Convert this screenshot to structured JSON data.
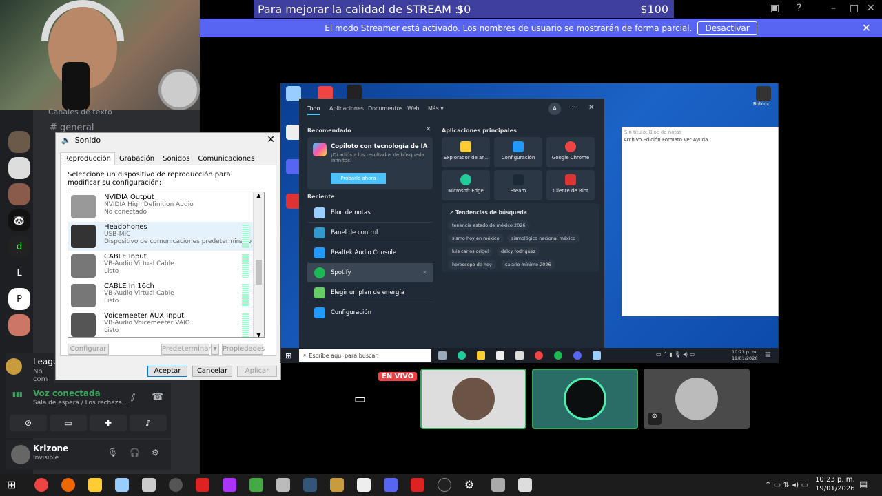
{
  "donation": {
    "text": "Para mejorar la calidad de STREAM :)",
    "current": "$0",
    "goal": "$100"
  },
  "streamer": {
    "message": "El modo Streamer está activado. Los nombres de usuario se mostrarán de forma parcial.",
    "button": "Desactivar"
  },
  "sidebar": {
    "letter": "L"
  },
  "channels": {
    "category": "Canales de texto",
    "items": [
      "general"
    ]
  },
  "game": {
    "name": "Leagu",
    "sub": "No com"
  },
  "voice": {
    "status": "Voz conectada",
    "location": "Sala de espera / Los rechaza..."
  },
  "user": {
    "name": "Krizone",
    "status": "Invisible"
  },
  "sonido": {
    "title": "Sonido",
    "tabs": [
      "Reproducción",
      "Grabación",
      "Sonidos",
      "Comunicaciones"
    ],
    "description": "Seleccione un dispositivo de reproducción para modificar su configuración:",
    "devices": [
      {
        "name": "NVIDIA Output",
        "driver": "NVIDIA High Definition Audio",
        "status": "No conectado"
      },
      {
        "name": "Headphones",
        "driver": "USB-MIC",
        "status": "Dispositivo de comunicaciones predeterminado"
      },
      {
        "name": "CABLE Input",
        "driver": "VB-Audio Virtual Cable",
        "status": "Listo"
      },
      {
        "name": "CABLE In 16ch",
        "driver": "VB-Audio Virtual Cable",
        "status": "Listo"
      },
      {
        "name": "Voicemeeter AUX Input",
        "driver": "VB-Audio Voicemeeter VAIO",
        "status": "Listo"
      }
    ],
    "btn_configurar": "Configurar",
    "btn_predeterminar": "Predeterminar",
    "btn_propiedades": "Propiedades",
    "btn_aceptar": "Aceptar",
    "btn_cancelar": "Cancelar",
    "btn_aplicar": "Aplicar"
  },
  "desktop": {
    "roblox": "Roblox",
    "notepad_title": "Sin título: Bloc de notas",
    "notepad_menu": "Archivo  Edición  Formato  Ver  Ayuda"
  },
  "startmenu": {
    "tabs": [
      "Todo",
      "Aplicaciones",
      "Documentos",
      "Web",
      "Más"
    ],
    "user_initial": "A",
    "recommended_header": "Recomendado",
    "copilot_title": "Copiloto con tecnología de IA",
    "copilot_desc": "¡Di adiós a los resultados de búsqueda infinitos!",
    "copilot_btn": "Probarlo ahora",
    "recent_header": "Reciente",
    "recent": [
      "Bloc de notas",
      "Panel de control",
      "Realtek Audio Console",
      "Spotify",
      "Elegir un plan de energía",
      "Configuración"
    ],
    "apps_header": "Aplicaciones principales",
    "apps": [
      "Explorador de ar...",
      "Configuración",
      "Google Chrome",
      "Microsoft Edge",
      "Steam",
      "Cliente de Riot"
    ],
    "trends_header": "Tendencias de búsqueda",
    "trends": [
      "tenencia estado de méxico 2026",
      "sismo hoy en méxico",
      "sismológico nacional méxico",
      "luis carlos origel",
      "delcy rodriguez",
      "horoscopo de hoy",
      "salario mínimo 2026"
    ],
    "search_placeholder": "Escribe aquí para buscar.",
    "clock_time": "10:23 p. m.",
    "clock_date": "19/01/2026"
  },
  "tiles": {
    "live": "EN VIVO"
  },
  "taskbar": {
    "time": "10:23 p. m.",
    "date": "19/01/2026"
  }
}
